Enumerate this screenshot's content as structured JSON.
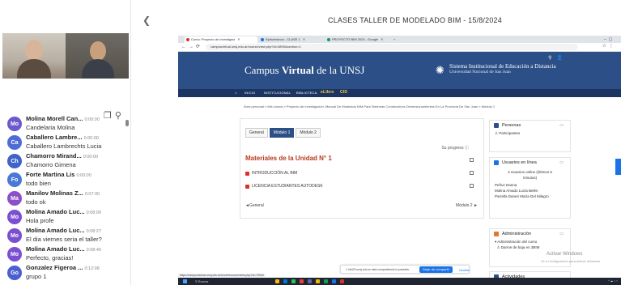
{
  "meeting_title": "CLASES TALLER DE MODELADO BIM - 15/8/2024",
  "chat_messages": [
    {
      "initials": "Mo",
      "name": "Molina Morell Can...",
      "time": "0:00:00",
      "text": "Candelaria Molina",
      "color": "#6a5acd"
    },
    {
      "initials": "Ca",
      "name": "Caballero Lambre...",
      "time": "0:00:00",
      "text": "Caballero Lambrechts Lucia",
      "color": "#4f6bd6"
    },
    {
      "initials": "Ch",
      "name": "Chamorro Mirand...",
      "time": "0:00:00",
      "text": "Chamorro Gimena",
      "color": "#3f63c9"
    },
    {
      "initials": "Fo",
      "name": "Forte Martina Lis",
      "time": "0:00:00",
      "text": "todo bien",
      "color": "#4a78d8"
    },
    {
      "initials": "Ma",
      "name": "Manilov Molinas Z...",
      "time": "0:07:00",
      "text": "todo ok",
      "color": "#8b4fc9"
    },
    {
      "initials": "Mo",
      "name": "Molina Amado Luc...",
      "time": "0:08:00",
      "text": "Hola profe",
      "color": "#7a4fd1"
    },
    {
      "initials": "Mo",
      "name": "Molina Amado Luc...",
      "time": "0:08:27",
      "text": "El dia viernes seria el taller?",
      "color": "#7a4fd1"
    },
    {
      "initials": "Mo",
      "name": "Molina Amado Luc...",
      "time": "0:08:40",
      "text": "Perfecto, gracias!",
      "color": "#7a4fd1"
    },
    {
      "initials": "Go",
      "name": "Gonzalez Figeroa ...",
      "time": "0:12:08",
      "text": "grupo 1",
      "color": "#4a5fd0"
    }
  ],
  "browser": {
    "tabs": [
      {
        "label": "Curso: Proyecto de Investigaci",
        "active": true,
        "color": "#d9302a"
      },
      {
        "label": "Kipfuchsinca - CLASE 1",
        "active": false,
        "color": "#1a73e8"
      },
      {
        "label": "PROYECTO BIM 2024 - Google",
        "active": false,
        "color": "#0f9d58"
      }
    ],
    "address": "campusvirtual.unsj.edu.ar/course/view.php?id=3890&section=1"
  },
  "site": {
    "brand_prefix": "Campus ",
    "brand_bold": "Virtual",
    "brand_suffix": " de la UNSJ",
    "sis_line1": "Sistema Institucional de Educación a Distancia",
    "sis_line2": "Universidad Nacional de San Juan",
    "nav": [
      "INICIO",
      "INSTITUCIONAL",
      "BIBLIOTECA",
      "eLibro",
      "CID"
    ],
    "breadcrumb": "Área personal  »  Mis cursos  »  Proyecto de Investigación: Manual De Modelado BIM Para Sistemas Constructivos Dimensionamientos En La Provincia De San Juan  »  Módulo 1"
  },
  "course": {
    "tabs": [
      "General",
      "Módulo 1",
      "Módulo 2"
    ],
    "active_tab": 1,
    "progress_label": "Su progreso",
    "section_title": "Materiales de la Unidad N° 1",
    "activities": [
      "INTRODUCCIÓN AL BIM",
      "LICENCIA ESTUDIANTES AUTODESK"
    ],
    "prev_label": "◄General",
    "next_label": "Módulo 2 ►"
  },
  "blocks": {
    "personas": {
      "title": "Personas",
      "link": "Participantes",
      "color": "#2b4f86"
    },
    "online": {
      "title": "Usuarios en línea",
      "color": "#1a73e8",
      "summary": "3 usuarios online (últimos 5 minutos)",
      "users": [
        "Peñuz Danna",
        "Molina Amado Lucía Belén",
        "Parrella Daneri María Del Milagro"
      ]
    },
    "admin": {
      "title": "Administración",
      "color": "#e0792b",
      "link1": "Administración del curso",
      "link2": "Darme de baja en 3BIM"
    },
    "activities_block": {
      "title": "Actividades"
    }
  },
  "share": {
    "message": "1 info23.unsj.edu.ar está compartiendo tu pantalla.",
    "stop_label": "Dejar de compartir",
    "hide_label": "Ocultar"
  },
  "status_url": "https://campusvirtual.unsj.edu.ar/mod/resource/view.php?id=79940",
  "watermark1": "Activar Windows",
  "watermark2": "Ve a Configuración para activar Windows.",
  "taskbar": {
    "search": "Buscar"
  }
}
